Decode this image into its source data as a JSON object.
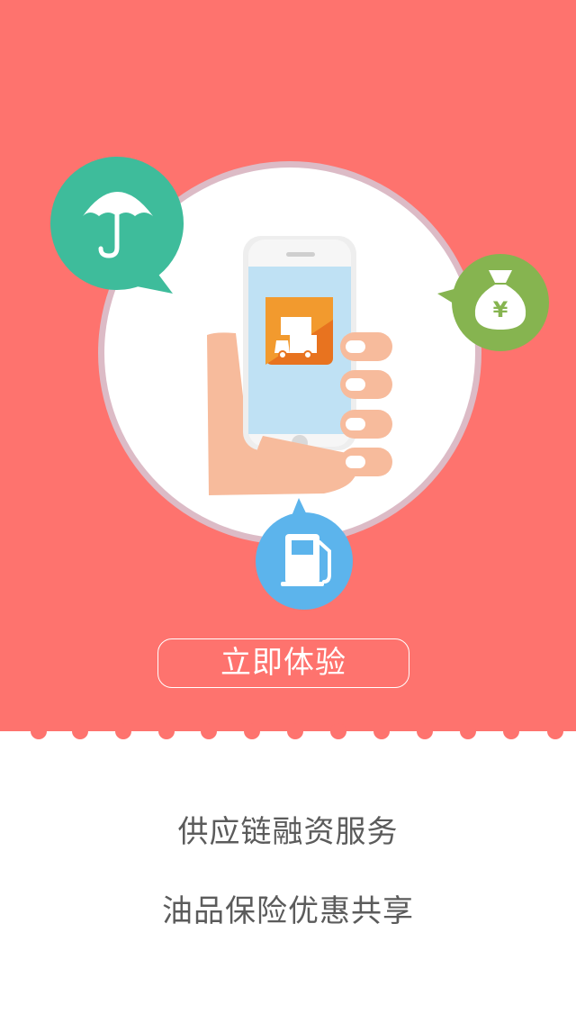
{
  "hero": {
    "background_color": "#fe736e",
    "cta_label": "立即体验"
  },
  "icons": {
    "top_left": "umbrella-icon",
    "right": "money-bag-yen-icon",
    "bottom": "fuel-pump-icon",
    "center": "hand-holding-phone-icon",
    "app": "delivery-truck-app-icon",
    "money_symbol": "¥"
  },
  "colors": {
    "umbrella_bubble": "#3ebc9b",
    "money_bubble": "#86b450",
    "fuel_bubble": "#5cb4ec",
    "circle_ring": "#dcbbc6"
  },
  "features": [
    {
      "label": "供应链融资服务"
    },
    {
      "label": "油品保险优惠共享"
    }
  ]
}
